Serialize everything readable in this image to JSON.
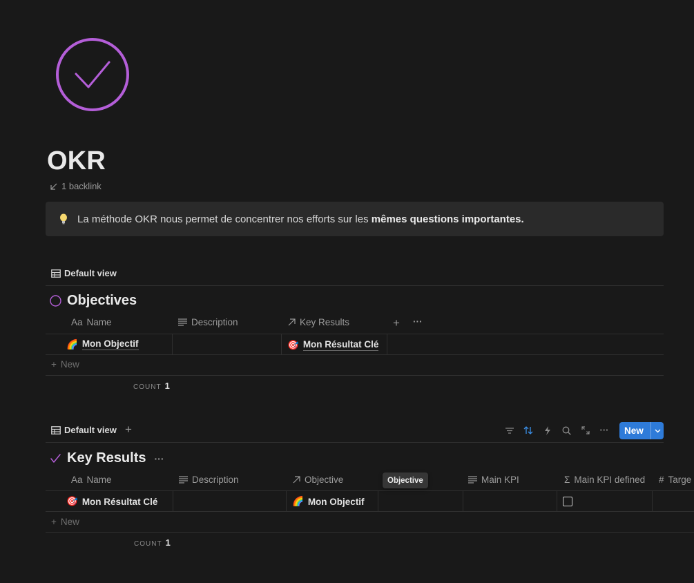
{
  "page": {
    "title": "OKR",
    "backlink_text": "1 backlink",
    "icon": "check-circle-icon",
    "accent_color": "#b45ed8"
  },
  "callout": {
    "icon": "lightbulb-icon",
    "text_plain": "La méthode OKR nous permet de concentrer nos efforts sur les ",
    "text_bold": "mêmes questions importantes."
  },
  "objectives_db": {
    "view_label": "Default view",
    "title": "Objectives",
    "columns": [
      {
        "icon": "Aa",
        "label": "Name"
      },
      {
        "icon": "text-lines-icon",
        "label": "Description"
      },
      {
        "icon": "relation-arrow-icon",
        "label": "Key Results"
      }
    ],
    "rows": [
      {
        "name_emoji": "🌈",
        "name": "Mon Objectif",
        "description": "",
        "key_results_emoji": "🎯",
        "key_results": "Mon Résultat Clé"
      }
    ],
    "new_label": "New",
    "count_label": "COUNT",
    "count_value": "1"
  },
  "key_results_db": {
    "view_label": "Default view",
    "title": "Key Results",
    "columns": [
      {
        "icon": "Aa",
        "label": "Name"
      },
      {
        "icon": "text-lines-icon",
        "label": "Description"
      },
      {
        "icon": "relation-arrow-icon",
        "label": "Objective"
      },
      {
        "icon": "text-lines-icon",
        "label": "Main KPI"
      },
      {
        "icon": "sigma-icon",
        "label": "Main KPI defined"
      },
      {
        "icon": "hash-icon",
        "label": "Targe"
      }
    ],
    "rows": [
      {
        "name_emoji": "🎯",
        "name": "Mon Résultat Clé",
        "description": "",
        "objective_emoji": "🌈",
        "objective": "Mon Objectif",
        "main_kpi": "",
        "main_kpi_defined": false
      }
    ],
    "tooltip": "Objective",
    "new_label": "New",
    "count_label": "COUNT",
    "count_value": "1",
    "toolbar": {
      "new_button_label": "New",
      "new_button_color": "#2e7bd9"
    }
  }
}
